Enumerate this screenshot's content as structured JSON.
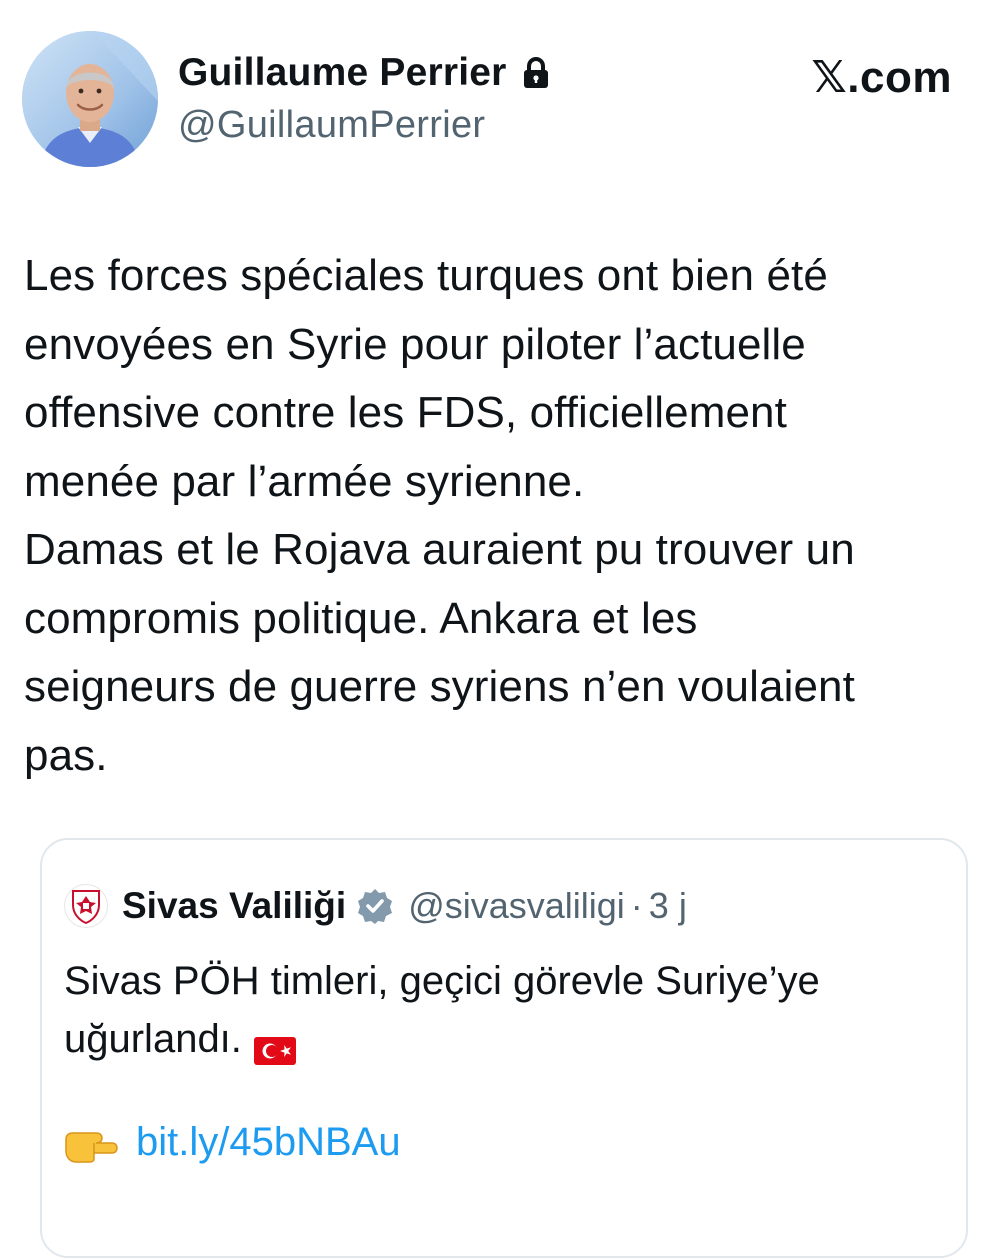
{
  "post": {
    "author": {
      "name": "Guillaume Perrier",
      "handle": "@GuillaumPerrier",
      "protected_icon": "lock-icon"
    },
    "brand": "𝕏.com",
    "text": "Les forces spéciales turques ont bien été\nenvoyées en Syrie pour piloter l’actuelle\noffensive contre les FDS, officiellement\nmenée par l’armée syrienne.\nDamas et le Rojava auraient pu trouver un\ncompromis politique. Ankara et les\nseigneurs de guerre syriens n’en voulaient\npas."
  },
  "quoted_post": {
    "author": {
      "name": "Sivas Valiliği",
      "handle": "@sivasvaliligi",
      "verified_icon": "verified-badge-icon"
    },
    "separator": "·",
    "time": "3 j",
    "text": "Sivas PÖH timleri, geçici görevle Suriye’ye\nuğurlandı.",
    "flag_icon": "turkish-flag-icon",
    "link_icon": "pointing-hand-icon",
    "link_text": "bit.ly/45bNBAu"
  },
  "colors": {
    "text_primary": "#0f1419",
    "text_secondary": "#536471",
    "link": "#1d9bf0",
    "border": "#e1e8ed",
    "flag_red": "#e30a17"
  }
}
